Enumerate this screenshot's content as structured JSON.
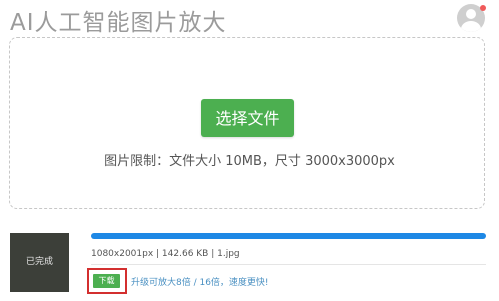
{
  "header": {
    "title": "AI人工智能图片放大",
    "avatar_icon": "user-avatar-icon",
    "notification_color": "#f05a5a"
  },
  "upload": {
    "select_button_label": "选择文件",
    "limit_text": "图片限制：文件大小 10MB，尺寸 3000x3000px"
  },
  "task": {
    "status_label": "已完成",
    "progress": 1.0,
    "file_info": "1080x2001px | 142.66 KB | 1.jpg",
    "download_label": "下载",
    "upgrade_text": "升级可放大8倍 / 16倍，速度更快!"
  },
  "colors": {
    "accent_green": "#4caf50",
    "progress_blue": "#1e88e5",
    "highlight_red": "#d32f2f",
    "link_blue": "#4a90c2"
  }
}
